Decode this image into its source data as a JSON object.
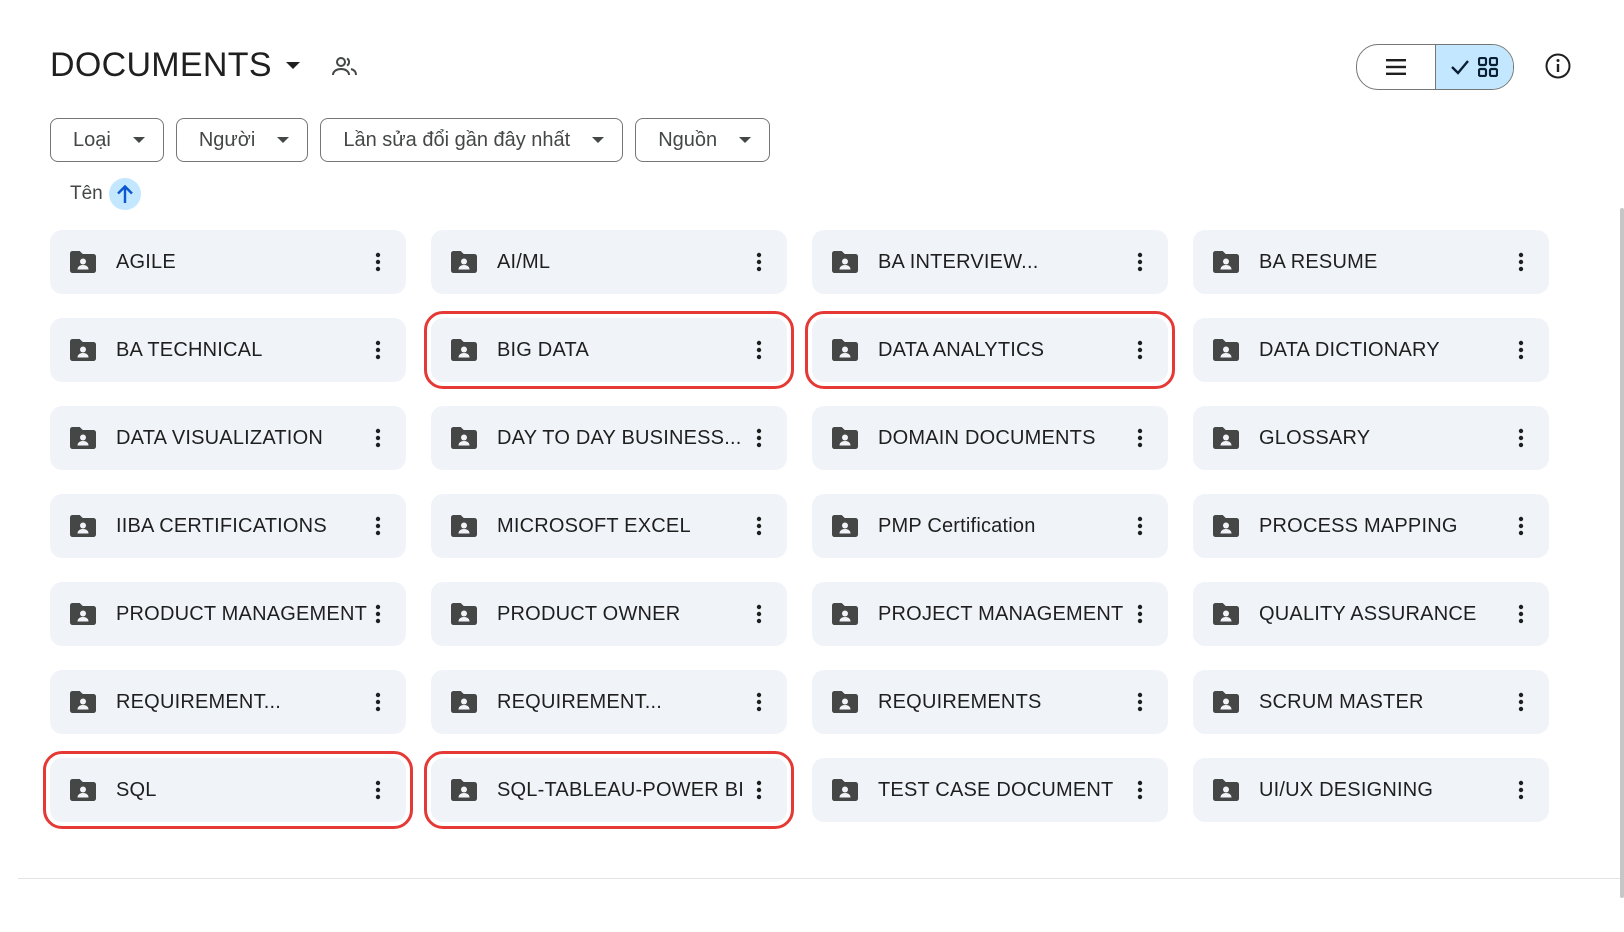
{
  "header": {
    "title": "DOCUMENTS"
  },
  "filters": [
    {
      "label": "Loại"
    },
    {
      "label": "Người"
    },
    {
      "label": "Lần sửa đổi gần đây nhất"
    },
    {
      "label": "Nguồn"
    }
  ],
  "sort": {
    "label": "Tên",
    "direction": "ascending"
  },
  "view": {
    "selected": "grid"
  },
  "folders": [
    {
      "name": "AGILE",
      "highlighted": false
    },
    {
      "name": "AI/ML",
      "highlighted": false
    },
    {
      "name": "BA INTERVIEW...",
      "highlighted": false
    },
    {
      "name": "BA RESUME",
      "highlighted": false
    },
    {
      "name": "BA TECHNICAL",
      "highlighted": false
    },
    {
      "name": "BIG DATA",
      "highlighted": true
    },
    {
      "name": "DATA ANALYTICS",
      "highlighted": true
    },
    {
      "name": "DATA DICTIONARY",
      "highlighted": false
    },
    {
      "name": "DATA VISUALIZATION",
      "highlighted": false
    },
    {
      "name": "DAY TO DAY BUSINESS...",
      "highlighted": false
    },
    {
      "name": "DOMAIN DOCUMENTS",
      "highlighted": false
    },
    {
      "name": "GLOSSARY",
      "highlighted": false
    },
    {
      "name": "IIBA CERTIFICATIONS",
      "highlighted": false
    },
    {
      "name": "MICROSOFT EXCEL",
      "highlighted": false
    },
    {
      "name": "PMP Certification",
      "highlighted": false
    },
    {
      "name": "PROCESS MAPPING",
      "highlighted": false
    },
    {
      "name": "PRODUCT MANAGEMENT",
      "highlighted": false
    },
    {
      "name": "PRODUCT OWNER",
      "highlighted": false
    },
    {
      "name": "PROJECT MANAGEMENT",
      "highlighted": false
    },
    {
      "name": "QUALITY ASSURANCE",
      "highlighted": false
    },
    {
      "name": "REQUIREMENT...",
      "highlighted": false
    },
    {
      "name": "REQUIREMENT...",
      "highlighted": false
    },
    {
      "name": "REQUIREMENTS",
      "highlighted": false
    },
    {
      "name": "SCRUM MASTER",
      "highlighted": false
    },
    {
      "name": "SQL",
      "highlighted": true
    },
    {
      "name": "SQL-TABLEAU-POWER BI",
      "highlighted": true
    },
    {
      "name": "TEST CASE DOCUMENT",
      "highlighted": false
    },
    {
      "name": "UI/UX DESIGNING",
      "highlighted": false
    }
  ],
  "colors": {
    "accent": "#c2e7ff",
    "card_bg": "#f0f4f9",
    "highlight_border": "#e53935",
    "icon": "#444746"
  },
  "icons": {
    "share": "people-icon",
    "list_view": "list-icon",
    "grid_view": "grid-icon",
    "check": "check-icon",
    "info": "info-icon",
    "sort": "arrow-up-icon",
    "folder": "shared-folder-icon",
    "more": "more-vert-icon"
  }
}
